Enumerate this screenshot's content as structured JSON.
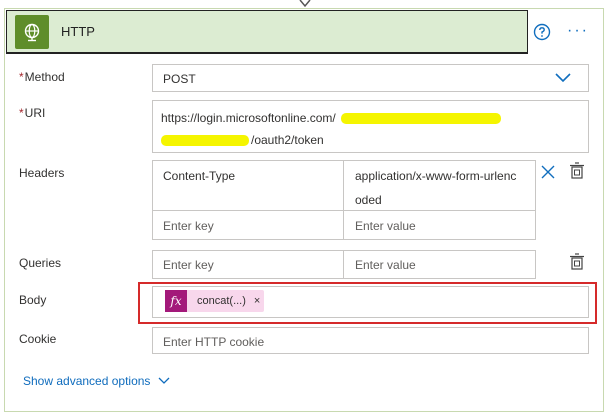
{
  "card": {
    "title": "HTTP",
    "icon": "globe-icon",
    "accent": "#5f8d2a",
    "header_bg": "#dcecd2"
  },
  "fields": {
    "method": {
      "label": "Method",
      "required": "*",
      "value": "POST"
    },
    "uri": {
      "label": "URI",
      "required": "*",
      "line1": "https://login.microsoftonline.com/",
      "line2": "/oauth2/token"
    },
    "headers": {
      "label": "Headers",
      "key1": "Content-Type",
      "value1_line1": "application/x-www-form-urlenc",
      "value1_line2": "oded",
      "key_placeholder": "Enter key",
      "value_placeholder": "Enter value"
    },
    "queries": {
      "label": "Queries",
      "key_placeholder": "Enter key",
      "value_placeholder": "Enter value"
    },
    "body": {
      "label": "Body",
      "token_fx": "fx",
      "token_text": "concat(...)",
      "token_remove": "×"
    },
    "cookie": {
      "label": "Cookie",
      "placeholder": "Enter HTTP cookie"
    }
  },
  "footer": {
    "show_advanced": "Show advanced options"
  },
  "colors": {
    "link": "#0f6cbd",
    "highlight": "#f5f500",
    "body_outline": "#d52a2a",
    "fx": "#a3197a"
  }
}
